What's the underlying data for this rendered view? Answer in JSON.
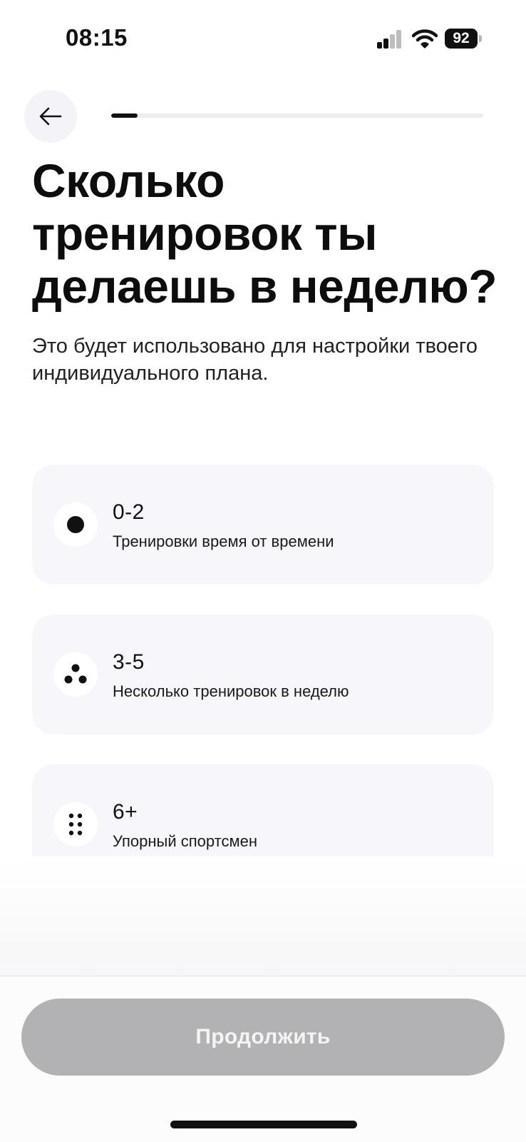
{
  "status_bar": {
    "time": "08:15",
    "battery_level": "92",
    "signal_bars_active": 2,
    "signal_bars_total": 4
  },
  "nav": {
    "back_icon": "arrow-left-icon",
    "progress_fraction": 0.07
  },
  "question": {
    "title": "Сколько тренировок ты делаешь в неделю?",
    "subtitle": "Это будет использовано для настройки твоего индивидуального плана."
  },
  "options": [
    {
      "value": "0-2",
      "description": "Тренировки время от времени",
      "icon": "one-dot-icon"
    },
    {
      "value": "3-5",
      "description": "Несколько тренировок в неделю",
      "icon": "three-dots-icon"
    },
    {
      "value": "6+",
      "description": "Упорный спортсмен",
      "icon": "six-dots-icon"
    }
  ],
  "footer": {
    "continue_label": "Продолжить"
  },
  "colors": {
    "accent": "#111111",
    "option_bg": "#f7f7fb",
    "button_disabled": "#b2b2b4"
  }
}
